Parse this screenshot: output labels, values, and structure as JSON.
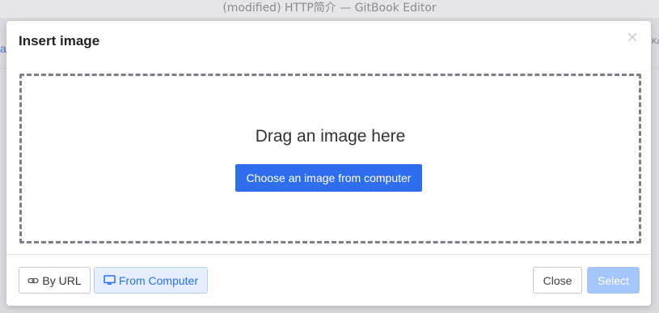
{
  "window": {
    "title": "(modified) HTTP简介 — GitBook Editor"
  },
  "background": {
    "left_fragment": "at",
    "right_fragment": "Ka"
  },
  "modal": {
    "title": "Insert image",
    "close_glyph": "×",
    "dropzone": {
      "prompt": "Drag an image here",
      "choose_button": "Choose an image from computer"
    },
    "tabs": [
      {
        "label": "By URL",
        "icon": "link-icon",
        "active": false
      },
      {
        "label": "From Computer",
        "icon": "monitor-icon",
        "active": true
      }
    ],
    "actions": {
      "close_label": "Close",
      "select_label": "Select",
      "select_disabled": true
    }
  },
  "colors": {
    "primary": "#2f6fef",
    "primary_disabled": "#a4c6fb",
    "active_tab_bg": "#e4eefc",
    "active_tab_text": "#2c6ee8"
  }
}
